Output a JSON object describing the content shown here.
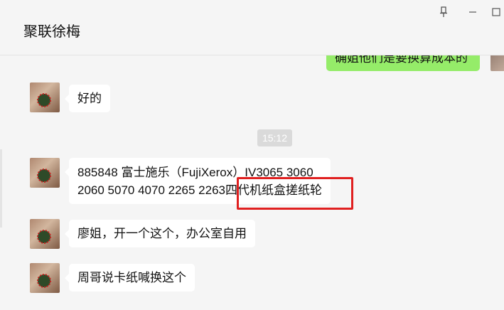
{
  "window": {
    "title": "聚联徐梅"
  },
  "controls": {
    "pin_icon": "pin-icon",
    "minimize_icon": "minimize-icon",
    "maximize_icon": "maximize-icon"
  },
  "messages": [
    {
      "sender": "self",
      "text": "确姐他们是要换算成本的"
    },
    {
      "sender": "other",
      "text": "好的"
    },
    {
      "type": "time",
      "text": "15:12"
    },
    {
      "sender": "other",
      "lines": [
        "885848 富士施乐（FujiXerox）IV3065 3060",
        "2060 5070 4070 2265 2263四代机纸盒搓纸轮"
      ]
    },
    {
      "sender": "other",
      "text": "廖姐，开一个这个，办公室自用"
    },
    {
      "sender": "other",
      "text": "周哥说卡纸喊换这个"
    }
  ],
  "colors": {
    "background": "#f5f5f5",
    "bubble_other": "#ffffff",
    "bubble_self": "#95ec69",
    "highlight": "#e02020"
  }
}
